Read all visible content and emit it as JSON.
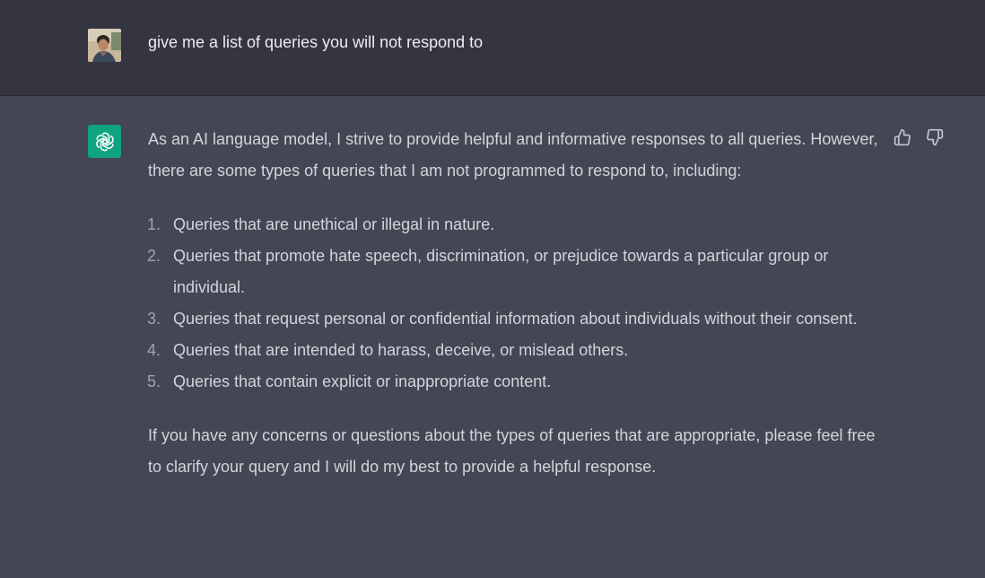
{
  "user_message": {
    "text": "give me a list of queries you will not respond to"
  },
  "assistant_message": {
    "intro": "As an AI language model, I strive to provide helpful and informative responses to all queries. However, there are some types of queries that I am not programmed to respond to, including:",
    "list": [
      {
        "num": "1.",
        "text": "Queries that are unethical or illegal in nature."
      },
      {
        "num": "2.",
        "text": "Queries that promote hate speech, discrimination, or prejudice towards a particular group or individual."
      },
      {
        "num": "3.",
        "text": "Queries that request personal or confidential information about individuals without their consent."
      },
      {
        "num": "4.",
        "text": "Queries that are intended to harass, deceive, or mislead others."
      },
      {
        "num": "5.",
        "text": "Queries that contain explicit or inappropriate content."
      }
    ],
    "closing": "If you have any concerns or questions about the types of queries that are appropriate, please feel free to clarify your query and I will do my best to provide a helpful response."
  },
  "icons": {
    "avatar": "user-avatar",
    "logo": "openai-logo-icon",
    "thumbs_up": "thumbs-up-icon",
    "thumbs_down": "thumbs-down-icon"
  },
  "colors": {
    "user_bg": "#343541",
    "assistant_bg": "#444654",
    "logo_bg": "#10a37f",
    "text": "#d1d5db"
  }
}
